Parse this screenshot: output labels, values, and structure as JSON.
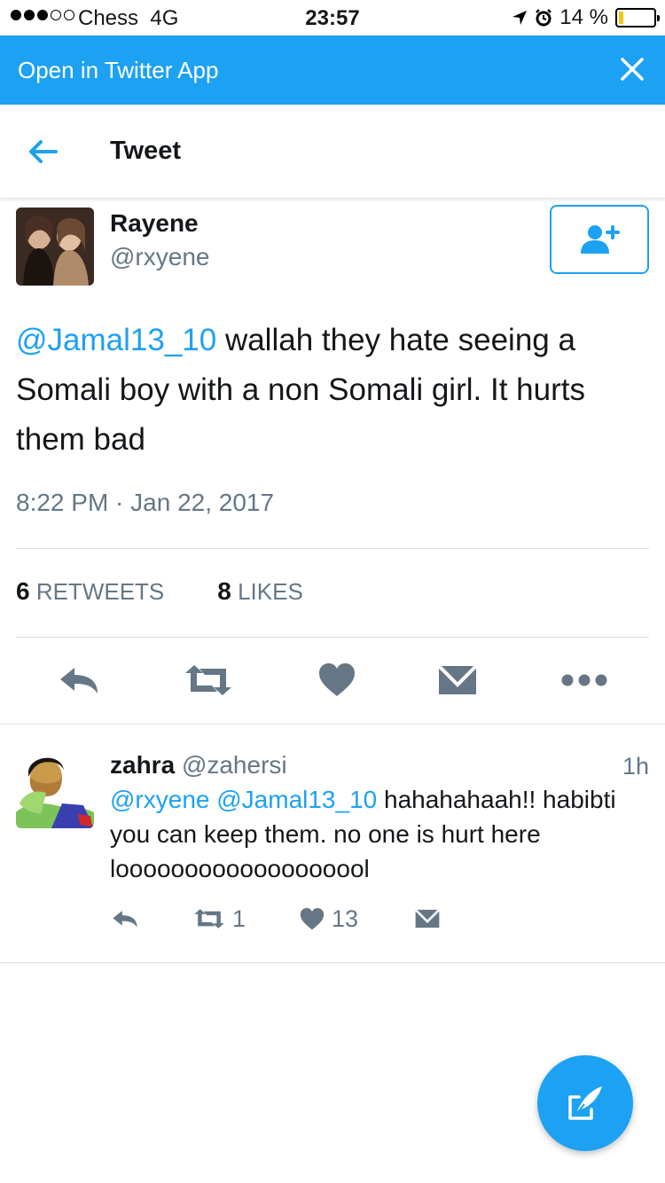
{
  "status_bar": {
    "carrier": "Chess",
    "network": "4G",
    "time": "23:57",
    "battery": "14 %",
    "battery_level": 0.14
  },
  "banner": {
    "label": "Open in Twitter App",
    "close_icon": "close-icon"
  },
  "header": {
    "title": "Tweet",
    "back_icon": "back-arrow-icon"
  },
  "tweet": {
    "author_name": "Rayene",
    "author_handle": "@rxyene",
    "mention": "@Jamal13_10",
    "text": " wallah they hate seeing a Somali boy with a non Somali girl. It hurts them bad",
    "timestamp": "8:22 PM · Jan 22, 2017",
    "retweets_count": "6",
    "retweets_label": "RETWEETS",
    "likes_count": "8",
    "likes_label": "LIKES"
  },
  "reply": {
    "name": "zahra",
    "handle": "@zahersi",
    "age": "1h",
    "mentions": "@rxyene @Jamal13_10",
    "text": " hahahahaah!! habibti you can keep them. no one is hurt here looooooooooooooooool",
    "retweets": "1",
    "likes": "13"
  },
  "colors": {
    "accent": "#1da1f2",
    "icon_gray": "#657786",
    "text": "#14171a"
  }
}
